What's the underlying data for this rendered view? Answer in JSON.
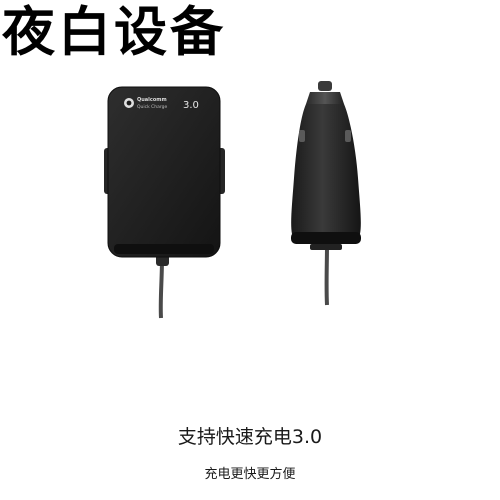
{
  "brand": {
    "text": "夜白设备"
  },
  "product": {
    "hub_logo_line1": "Qualcomm",
    "hub_logo_line2": "Quick Charge",
    "hub_logo_version": "3.0",
    "body_color": "#1c1c1c"
  },
  "caption": {
    "headline": "支持快速充电3.0",
    "subline": "充电更快更方便"
  }
}
